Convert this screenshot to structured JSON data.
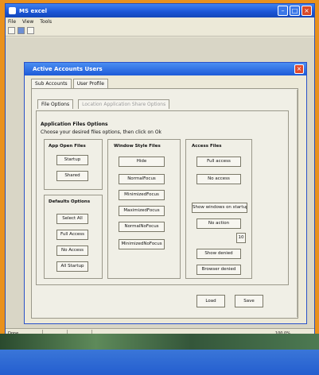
{
  "window": {
    "title": "MS excel"
  },
  "menu": [
    "File",
    "View",
    "Tools"
  ],
  "dialog": {
    "title": "Active Accounts Users",
    "tabs": [
      "Sub Accounts",
      "User Profile"
    ],
    "subtabs": [
      "File Options",
      "Location Application Share Options"
    ],
    "section_title": "Application Files Options",
    "section_subtitle": "Choose your desired files options, then click on Ok"
  },
  "app_open": {
    "title": "App Open Files",
    "buttons": [
      "Startup",
      "Shared"
    ]
  },
  "window_style": {
    "title": "Window Style Files",
    "buttons": [
      "Hide",
      "NormalFocus",
      "MinimizedFocus",
      "MaximizedFocus",
      "NormalNoFocus",
      "MinimizedNoFocus"
    ]
  },
  "access": {
    "title": "Access Files",
    "buttons": [
      "Full access",
      "No access",
      "Show windows on startup",
      "No action",
      "Show denied",
      "Browser denied"
    ],
    "small_value": "10"
  },
  "defaults": {
    "title": "Defaults Options",
    "buttons": [
      "Select All",
      "Full Access",
      "No Access",
      "All Startup"
    ]
  },
  "footer": {
    "load": "Load",
    "save": "Save"
  },
  "status": {
    "left": "Done",
    "right": "100.0%"
  }
}
